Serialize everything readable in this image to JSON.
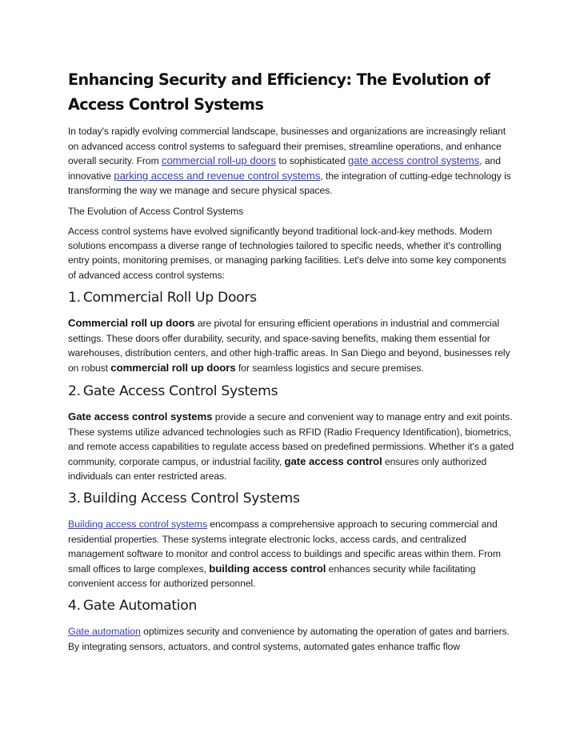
{
  "document": {
    "title": "Enhancing Security and Efficiency: The Evolution of Access Control Systems",
    "intro": {
      "part1": "In today's rapidly evolving commercial landscape, businesses and organizations are increasingly reliant on advanced access control systems to safeguard their premises, streamline operations, and enhance overall security. From ",
      "link1": "commercial roll-up doors",
      "part2": " to sophisticated ",
      "link2": "gate access control systems",
      "part3": ", and innovative ",
      "link3": "parking access and revenue control systems",
      "part4": ", the integration of cutting-edge technology is transforming the way we manage and secure physical spaces."
    },
    "subtitle": "The Evolution of Access Control Systems",
    "overview": "Access control systems have evolved significantly beyond traditional lock-and-key methods. Modern solutions encompass a diverse range of technologies tailored to specific needs, whether it's controlling entry points, monitoring premises, or managing parking facilities. Let's delve into some key components of advanced access control systems:",
    "sections": [
      {
        "number": "1.",
        "heading": "Commercial Roll Up Doors",
        "lead": "Commercial roll up doors",
        "part1": " are pivotal for ensuring efficient operations in industrial and commercial settings. These doors offer durability, security, and space-saving benefits, making them essential for warehouses, distribution centers, and other high-traffic areas. In San Diego and beyond, businesses rely on robust ",
        "emphasis": "commercial roll up doors",
        "part2": " for seamless logistics and secure premises."
      },
      {
        "number": "2.",
        "heading": "Gate Access Control Systems",
        "lead": "Gate access control systems",
        "part1": " provide a secure and convenient way to manage entry and exit points. These systems utilize advanced technologies such as RFID (Radio Frequency Identification), biometrics, and remote access capabilities to regulate access based on predefined permissions. Whether it's a gated community, corporate campus, or industrial facility, ",
        "emphasis": "gate access control",
        "part2": " ensures only authorized individuals can enter restricted areas."
      },
      {
        "number": "3.",
        "heading": "Building Access Control Systems",
        "lead": "Building access control systems",
        "part1": " encompass a comprehensive approach to securing commercial and residential properties. These systems integrate electronic locks, access cards, and centralized management software to monitor and control access to buildings and specific areas within them. From small offices to large complexes, ",
        "emphasis": "building access control",
        "part2": " enhances security while facilitating convenient access for authorized personnel."
      },
      {
        "number": "4.",
        "heading": "Gate Automation",
        "lead": "Gate automation",
        "part1": " optimizes security and convenience by automating the operation of gates and barriers. By integrating sensors, actuators, and control systems, automated gates enhance traffic flow"
      }
    ]
  }
}
